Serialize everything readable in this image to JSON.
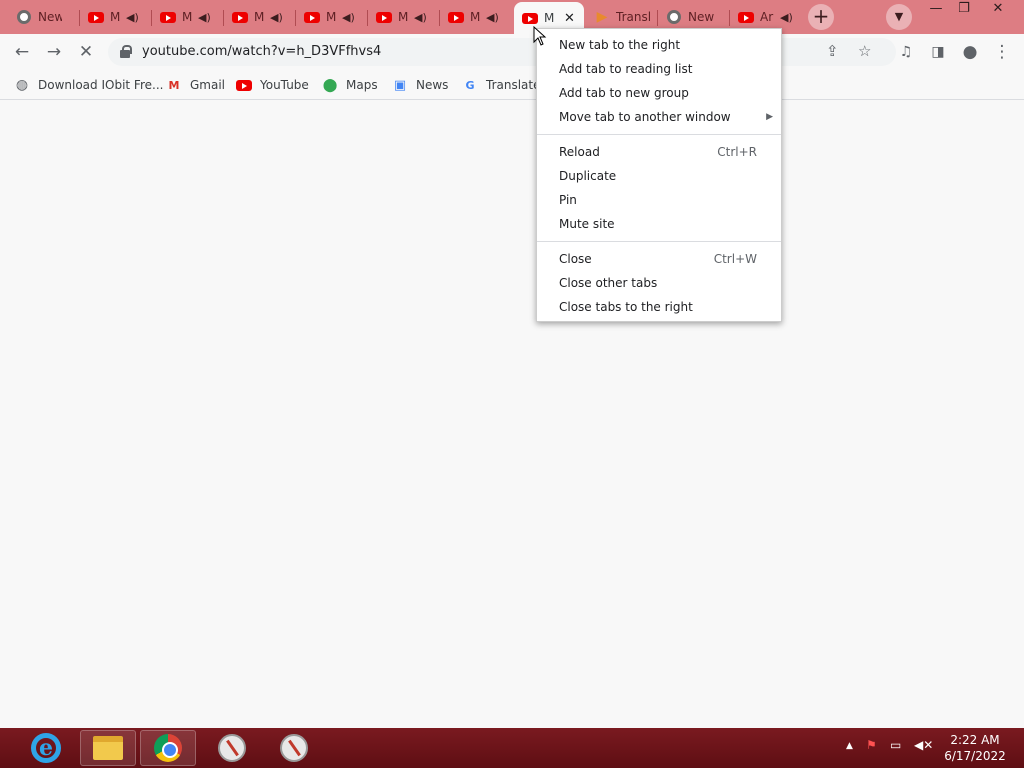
{
  "tabs": [
    {
      "label": "New T",
      "icon": "chrome-icon",
      "audio": false
    },
    {
      "label": "M",
      "icon": "youtube-icon",
      "audio": true
    },
    {
      "label": "M",
      "icon": "youtube-icon",
      "audio": true
    },
    {
      "label": "M",
      "icon": "youtube-icon",
      "audio": true
    },
    {
      "label": "M",
      "icon": "youtube-icon",
      "audio": true
    },
    {
      "label": "M",
      "icon": "youtube-icon",
      "audio": true
    },
    {
      "label": "M",
      "icon": "youtube-icon",
      "audio": true
    },
    {
      "label": "M",
      "icon": "youtube-icon",
      "audio": false,
      "active": true
    },
    {
      "label": "Transl",
      "icon": "translate-icon",
      "audio": false
    },
    {
      "label": "New",
      "icon": "chrome-icon",
      "audio": false
    },
    {
      "label": "Ar",
      "icon": "youtube-icon",
      "audio": true
    }
  ],
  "toolbar": {
    "url": "youtube.com/watch?v=h_D3VFfhvs4"
  },
  "bookmarks": [
    {
      "label": "Download IObit Fre...",
      "icon": "globe-icon"
    },
    {
      "label": "Gmail",
      "icon": "gmail-icon"
    },
    {
      "label": "YouTube",
      "icon": "youtube-icon"
    },
    {
      "label": "Maps",
      "icon": "maps-icon"
    },
    {
      "label": "News",
      "icon": "news-icon"
    },
    {
      "label": "Translate",
      "icon": "translate-icon"
    }
  ],
  "context_menu": {
    "items": [
      {
        "label": "New tab to the right",
        "shortcut": ""
      },
      {
        "label": "Add tab to reading list",
        "shortcut": ""
      },
      {
        "label": "Add tab to new group",
        "shortcut": ""
      },
      {
        "label": "Move tab to another window",
        "shortcut": ""
      },
      {
        "label": "Reload",
        "shortcut": "Ctrl+R"
      },
      {
        "label": "Duplicate",
        "shortcut": ""
      },
      {
        "label": "Pin",
        "shortcut": ""
      },
      {
        "label": "Mute site",
        "shortcut": ""
      },
      {
        "label": "Close",
        "shortcut": "Ctrl+W"
      },
      {
        "label": "Close other tabs",
        "shortcut": ""
      },
      {
        "label": "Close tabs to the right",
        "shortcut": ""
      }
    ]
  },
  "taskbar": {
    "time": "2:22 AM",
    "date": "6/17/2022"
  },
  "colors": {
    "tabstrip": "#dd7d83",
    "taskbar": "#6b1419"
  }
}
